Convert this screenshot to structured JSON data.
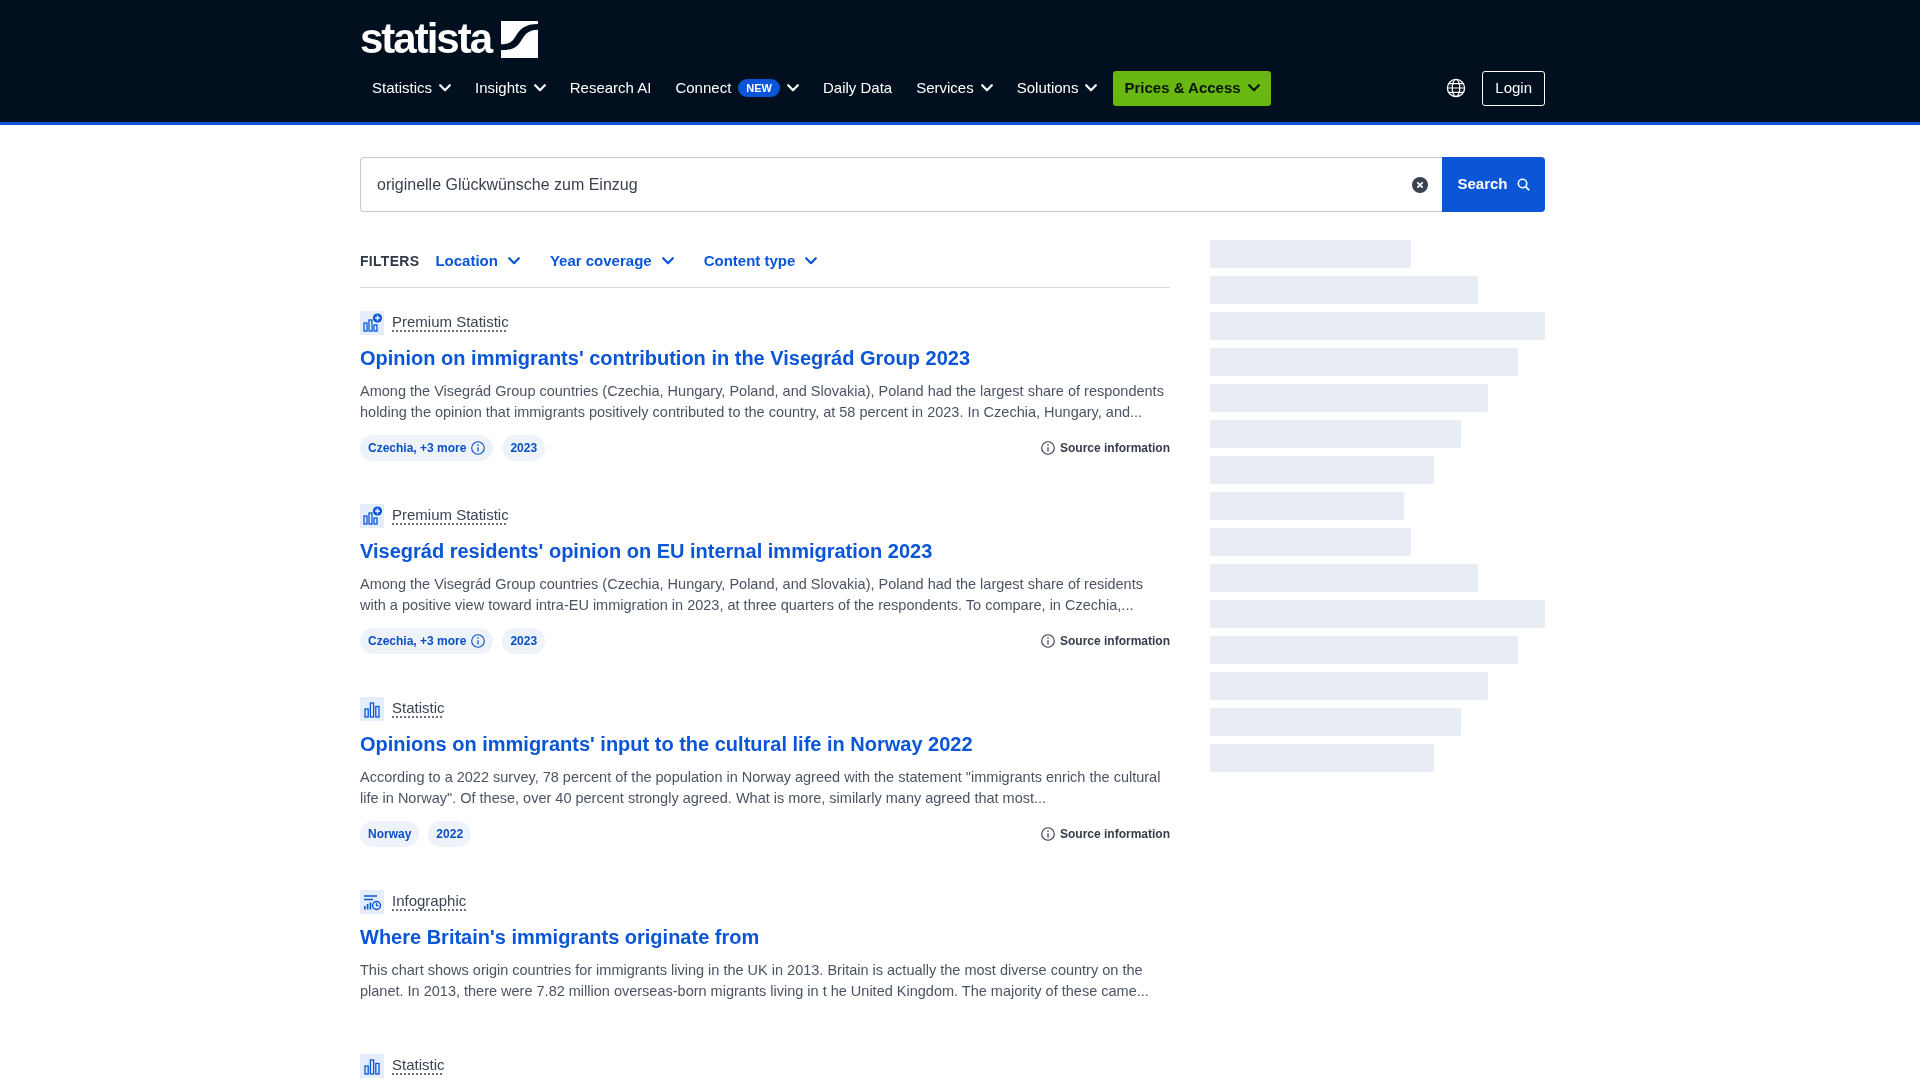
{
  "header": {
    "logo": "statista",
    "nav": [
      {
        "label": "Statistics",
        "kind": "link",
        "dropdown": true
      },
      {
        "label": "Insights",
        "kind": "link",
        "dropdown": true
      },
      {
        "label": "Research AI",
        "kind": "link",
        "dropdown": false
      },
      {
        "label": "Connect",
        "kind": "link",
        "dropdown": true,
        "badge": "NEW"
      },
      {
        "label": "Daily Data",
        "kind": "link",
        "dropdown": false
      },
      {
        "label": "Services",
        "kind": "link",
        "dropdown": true
      },
      {
        "label": "Solutions",
        "kind": "link",
        "dropdown": true
      },
      {
        "label": "Prices & Access",
        "kind": "cta",
        "dropdown": true
      }
    ],
    "login": "Login"
  },
  "search": {
    "value": "originelle Glückwünsche zum Einzug",
    "button": "Search"
  },
  "filters": {
    "label": "FILTERS",
    "items": [
      "Location",
      "Year coverage",
      "Content type"
    ]
  },
  "results": [
    {
      "kind": "premium-statistic",
      "type_label": "Premium Statistic",
      "title": "Opinion on immigrants' contribution in the Visegrád Group 2023",
      "description": "Among the Visegrád Group countries (Czechia, Hungary, Poland, and Slovakia), Poland had the largest share of respondents holding the opinion that immigrants positively contributed to the country, at 58 percent in 2023. In Czechia, Hungary, and...",
      "tags": [
        {
          "text": "Czechia, +3 more",
          "info": true
        },
        {
          "text": "2023",
          "info": false
        }
      ],
      "source_info": "Source information"
    },
    {
      "kind": "premium-statistic",
      "type_label": "Premium Statistic",
      "title": "Visegrád residents' opinion on EU internal immigration 2023",
      "description": "Among the Visegrád Group countries (Czechia, Hungary, Poland, and Slovakia), Poland had the largest share of residents with a positive view toward intra-EU immigration in 2023, at three quarters of the respondents. To compare, in Czechia,...",
      "tags": [
        {
          "text": "Czechia, +3 more",
          "info": true
        },
        {
          "text": "2023",
          "info": false
        }
      ],
      "source_info": "Source information"
    },
    {
      "kind": "statistic",
      "type_label": "Statistic",
      "title": "Opinions on immigrants' input to the cultural life in Norway 2022",
      "description": "According to a 2022 survey, 78 percent of the population in Norway agreed with the statement \"immigrants enrich the cultural life in Norway\". Of these, over 40 percent strongly agreed. What is more, similarly many agreed that most...",
      "tags": [
        {
          "text": "Norway",
          "info": false
        },
        {
          "text": "2022",
          "info": false
        }
      ],
      "source_info": "Source information"
    },
    {
      "kind": "infographic",
      "type_label": "Infographic",
      "title": "Where Britain's immigrants originate from",
      "description": "This chart shows origin countries for immigrants living in the UK in 2013. Britain is actually the most diverse country on the planet. In 2013, there were 7.82 million overseas-born migrants living in t he United Kingdom. The majority of these came..."
    },
    {
      "kind": "statistic",
      "type_label": "Statistic"
    }
  ],
  "sidebar": {
    "loading": true
  }
}
